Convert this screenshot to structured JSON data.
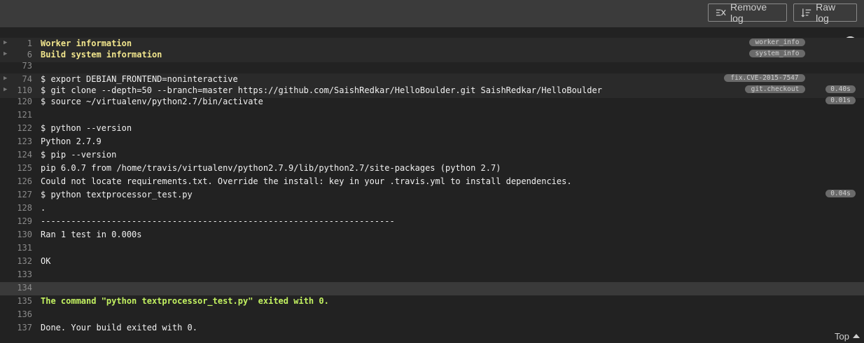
{
  "toolbar": {
    "remove_log_label": "Remove log",
    "raw_log_label": "Raw log",
    "remove_icon": "remove-log-icon",
    "raw_icon": "raw-log-icon"
  },
  "log_lines": [
    {
      "num": "1",
      "text": "Worker information",
      "style": "yellow",
      "folded": true,
      "tag": "worker_info"
    },
    {
      "num": "6",
      "text": "Build system information",
      "style": "yellow",
      "folded": true,
      "tag": "system_info"
    },
    {
      "num": "73",
      "text": ""
    },
    {
      "num": "74",
      "text": "$ export DEBIAN_FRONTEND=noninteractive",
      "folded": true,
      "tag": "fix.CVE-2015-7547"
    },
    {
      "num": "110",
      "text": "$ git clone --depth=50 --branch=master https://github.com/SaishRedkar/HelloBoulder.git SaishRedkar/HelloBoulder",
      "folded": true,
      "tag": "git.checkout",
      "duration": "0.40s"
    },
    {
      "num": "120",
      "text": "$ source ~/virtualenv/python2.7/bin/activate",
      "duration": "0.01s"
    },
    {
      "num": "121",
      "text": ""
    },
    {
      "num": "122",
      "text": "$ python --version"
    },
    {
      "num": "123",
      "text": "Python 2.7.9"
    },
    {
      "num": "124",
      "text": "$ pip --version"
    },
    {
      "num": "125",
      "text": "pip 6.0.7 from /home/travis/virtualenv/python2.7.9/lib/python2.7/site-packages (python 2.7)"
    },
    {
      "num": "126",
      "text": "Could not locate requirements.txt. Override the install: key in your .travis.yml to install dependencies."
    },
    {
      "num": "127",
      "text": "$ python textprocessor_test.py",
      "duration": "0.04s"
    },
    {
      "num": "128",
      "text": "."
    },
    {
      "num": "129",
      "text": "----------------------------------------------------------------------"
    },
    {
      "num": "130",
      "text": "Ran 1 test in 0.000s"
    },
    {
      "num": "131",
      "text": ""
    },
    {
      "num": "132",
      "text": "OK"
    },
    {
      "num": "133",
      "text": ""
    },
    {
      "num": "134",
      "text": "",
      "highlighted": true
    },
    {
      "num": "135",
      "text": "The command \"python textprocessor_test.py\" exited with 0.",
      "style": "green"
    },
    {
      "num": "136",
      "text": ""
    },
    {
      "num": "137",
      "text": "Done. Your build exited with 0."
    }
  ],
  "footer": {
    "top_label": "Top",
    "top_icon": "caret-up-icon"
  },
  "status_icon": "build-status-circle-icon"
}
